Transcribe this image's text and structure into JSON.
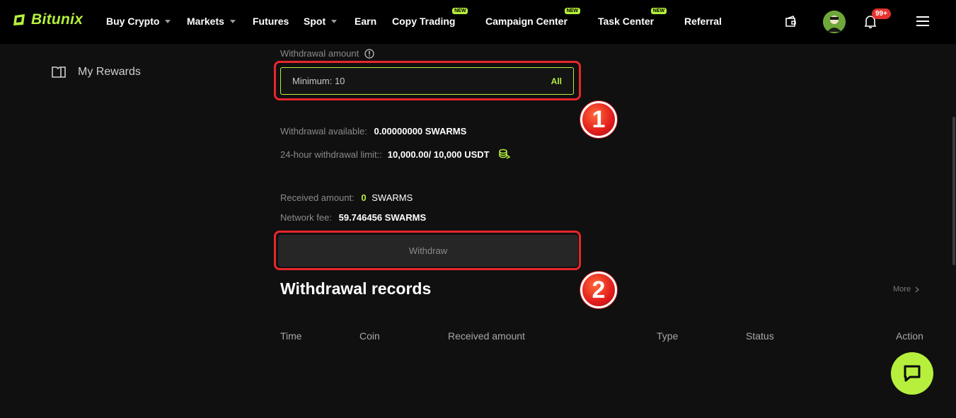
{
  "brand": {
    "name": "Bitunix"
  },
  "nav": {
    "items": [
      {
        "label": "Buy Crypto",
        "caret": true
      },
      {
        "label": "Markets",
        "caret": true
      },
      {
        "label": "Futures"
      },
      {
        "label": "Spot",
        "caret": true
      },
      {
        "label": "Earn"
      },
      {
        "label": "Copy Trading",
        "badge": "NEW"
      },
      {
        "label": "Campaign Center",
        "badge": "NEW"
      },
      {
        "label": "Task Center",
        "badge": "NEW"
      },
      {
        "label": "Referral"
      }
    ],
    "notifications_badge": "99+"
  },
  "sidebar": {
    "my_rewards": "My Rewards"
  },
  "withdraw": {
    "amount_label": "Withdrawal amount",
    "amount_placeholder": "Minimum: 10",
    "all_label": "All",
    "available_label": "Withdrawal available:",
    "available_value": "0.00000000 SWARMS",
    "limit_label": "24-hour withdrawal limit::",
    "limit_value": "10,000.00/ 10,000 USDT",
    "received_label": "Received amount:",
    "received_value_num": "0",
    "received_value_unit": "SWARMS",
    "fee_label": "Network fee:",
    "fee_value": "59.746456 SWARMS",
    "button_label": "Withdraw"
  },
  "annotations": {
    "step1": "1",
    "step2": "2"
  },
  "records": {
    "title": "Withdrawal records",
    "more": "More",
    "columns": [
      "Time",
      "Coin",
      "Received amount",
      "Type",
      "Status",
      "Action"
    ]
  },
  "colors": {
    "accent": "#b6f03c",
    "highlight": "#e8262b",
    "background": "#101010"
  }
}
